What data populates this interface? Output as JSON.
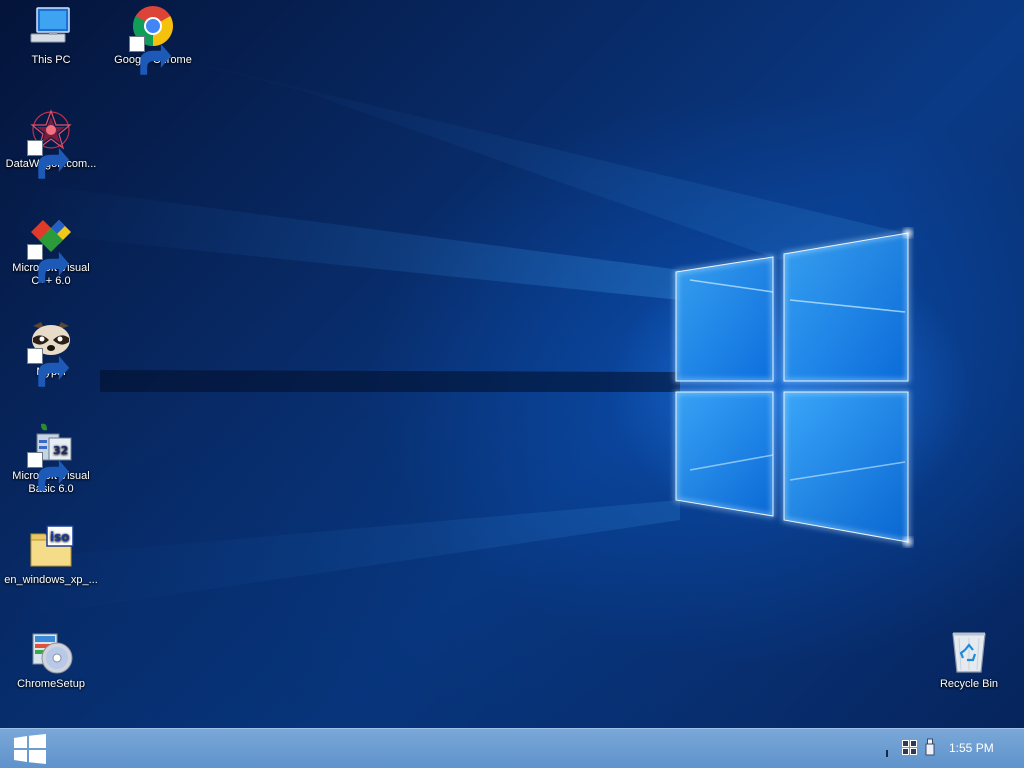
{
  "desktop": {
    "icons": [
      {
        "label": "This PC",
        "icon": "this-pc-icon"
      },
      {
        "label": "Google Chrome",
        "icon": "chrome-icon"
      },
      {
        "label": "DataWagon.com...",
        "icon": "datawagon-icon"
      },
      {
        "label": "Microsoft Visual\nC++ 6.0",
        "icon": "visual-cpp-icon"
      },
      {
        "label": "Mypal",
        "icon": "mypal-icon"
      },
      {
        "label": "Microsoft Visual\nBasic 6.0",
        "icon": "visual-basic-icon"
      },
      {
        "label": "en_windows_xp_...",
        "icon": "iso-file-icon"
      },
      {
        "label": "ChromeSetup",
        "icon": "installer-icon"
      },
      {
        "label": "Recycle Bin",
        "icon": "recycle-bin-icon"
      }
    ]
  },
  "taskbar": {
    "start_icon": "windows-logo-icon",
    "tray": {
      "icons": [
        "tray-chevron-icon",
        "network-icon",
        "usb-icon"
      ],
      "clock": "1:55 PM"
    }
  },
  "colors": {
    "taskbar": "#6a9ad0",
    "accent_blue": "#3aa0ff"
  }
}
